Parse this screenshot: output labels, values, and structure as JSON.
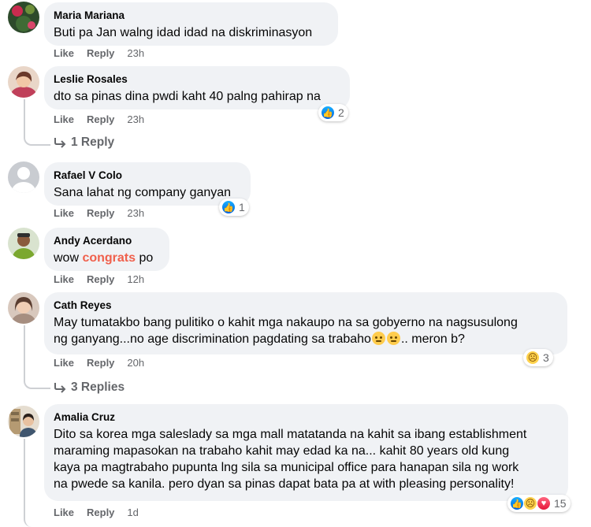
{
  "actions": {
    "like": "Like",
    "reply": "Reply"
  },
  "comments": [
    {
      "name": "Maria Mariana",
      "text": "Buti pa Jan walng idad idad na diskriminasyon",
      "time": "23h"
    },
    {
      "name": "Leslie Rosales",
      "text": "dto sa pinas dina pwdi kaht 40 palng pahirap na",
      "time": "23h",
      "reactions_count": "2",
      "reactions": [
        "like"
      ],
      "replies": "1 Reply"
    },
    {
      "name": "Rafael V Colo",
      "text": "Sana lahat ng company ganyan",
      "time": "23h",
      "reactions_count": "1",
      "reactions": [
        "like"
      ]
    },
    {
      "name": "Andy Acerdano",
      "text_pre": "wow ",
      "text_highlight": "congrats",
      "text_post": " po",
      "time": "12h"
    },
    {
      "name": "Cath Reyes",
      "text_line1": "May tumatakbo bang pulitiko o kahit mga nakaupo na sa gobyerno na nagsusulong",
      "text_line2_pre": "ng ganyang...no age discrimination pagdating sa trabaho",
      "text_line2_post": ".. meron b?",
      "time": "20h",
      "reactions_count": "3",
      "reactions": [
        "sad"
      ],
      "replies": "3 Replies"
    },
    {
      "name": "Amalia Cruz",
      "text_lines": [
        "Dito sa korea mga saleslady sa mga mall matatanda na kahit sa ibang establishment",
        "maraming mapasokan na trabaho kahit may edad ka na... kahit 80 years old kung",
        "kaya pa magtrabaho pupunta lng sila sa municipal office para hanapan sila ng work",
        "na pwede sa kanila. pero dyan sa pinas dapat bata pa at with pleasing personality!"
      ],
      "time": "1d",
      "reactions_count": "15",
      "reactions": [
        "like",
        "sad",
        "love"
      ]
    }
  ]
}
